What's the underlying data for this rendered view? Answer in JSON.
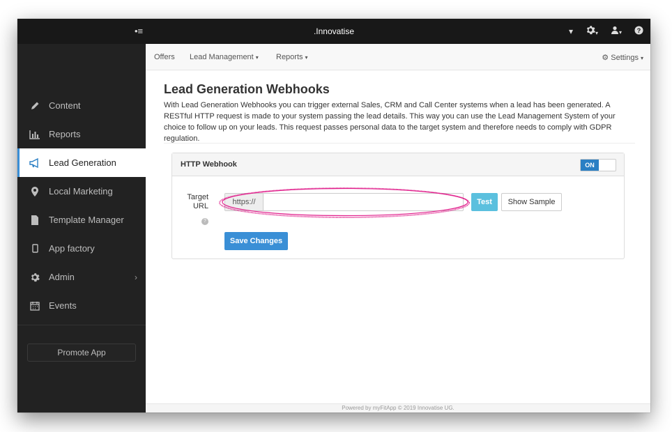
{
  "topbar": {
    "sidebar_toggle": "•≡",
    "brand": ".Innovatise",
    "icons": [
      "caret-down-icon",
      "gear-icon",
      "user-icon",
      "help-icon"
    ]
  },
  "sidebar": {
    "items": [
      {
        "label": "Content",
        "icon": "pencil-icon"
      },
      {
        "label": "Reports",
        "icon": "bar-chart-icon"
      },
      {
        "label": "Lead Generation",
        "icon": "megaphone-icon",
        "active": true
      },
      {
        "label": "Local Marketing",
        "icon": "map-marker-icon"
      },
      {
        "label": "Template Manager",
        "icon": "file-icon"
      },
      {
        "label": "App factory",
        "icon": "mobile-icon"
      },
      {
        "label": "Admin",
        "icon": "gear-icon"
      },
      {
        "label": "Events",
        "icon": "calendar-icon"
      }
    ],
    "admin_chevron": "›",
    "promote_label": "Promote App"
  },
  "navbar": {
    "offers": "Offers",
    "lead_management": "Lead Management",
    "reports": "Reports",
    "settings": "Settings"
  },
  "main": {
    "title": "Lead Generation Webhooks",
    "description": "With Lead Generation Webhooks you can trigger external Sales, CRM and Call Center systems when a lead has been generated. A RESTful HTTP request is made to your system passing the lead details. This way you can use the Lead Management System of your choice to follow up on your leads. This request passes personal data to the target system and therefore needs to comply with GDPR regulation."
  },
  "webhook_panel": {
    "heading": "HTTP Webhook",
    "toggle_label": "ON",
    "target_label_1": "Target",
    "target_label_2": "URL",
    "url_prefix": "https://",
    "url_value": "",
    "test_button": "Test",
    "sample_button": "Show Sample",
    "save_button": "Save Changes"
  },
  "footer": {
    "text": "Powered by myFitApp © 2019 Innovatise UG."
  },
  "colors": {
    "accent": "#3a8fd6",
    "info_button": "#5bc0de",
    "sidebar_bg": "#222222",
    "topbar_bg": "#181818",
    "annotation": "#e0208c"
  }
}
